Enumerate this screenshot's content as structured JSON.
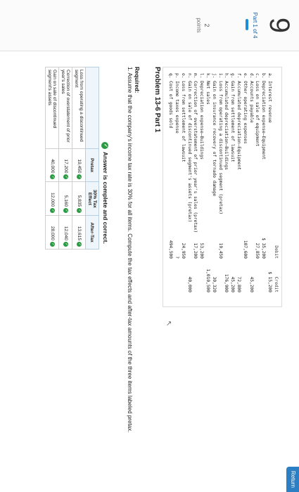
{
  "rail": {
    "question_number": "9",
    "part_label": "Part 1 of 4",
    "points_value": "2",
    "points_label": "points"
  },
  "return_button": "Return",
  "ledger": {
    "header": {
      "debit": "Debit",
      "credit": "Credit"
    },
    "rows": [
      {
        "account": "a. Interest revenue",
        "debit": "",
        "credit": "$ 15,200"
      },
      {
        "account": "b. Depreciation expense—Equipment",
        "debit": "$ 35,200",
        "credit": ""
      },
      {
        "account": "c. Loss on sale of equipment",
        "debit": "27,850",
        "credit": ""
      },
      {
        "account": "d. Accounts payable",
        "debit": "",
        "credit": "45,200"
      },
      {
        "account": "e. Other operating expenses",
        "debit": "107,600",
        "credit": ""
      },
      {
        "account": "f. Accumulated depreciation—Equipment",
        "debit": "",
        "credit": "72,800"
      },
      {
        "account": "g. Gain from settlement of lawsuit",
        "debit": "",
        "credit": "45,200"
      },
      {
        "account": "h. Accumulated depreciation—Buildings",
        "debit": "",
        "credit": "176,900"
      },
      {
        "account": "i. Loss from operating a discontinued segment (pretax)",
        "debit": "19,450",
        "credit": ""
      },
      {
        "account": "j. Gain on insurance recovery of tornado damage",
        "debit": "",
        "credit": "30,320"
      },
      {
        "account": "k. Net sales",
        "debit": "",
        "credit": "1,010,500"
      },
      {
        "account": "l. Depreciation expense—Buildings",
        "debit": "53,200",
        "credit": ""
      },
      {
        "account": "m. Correction of overstatement of prior year's sales (pretax)",
        "debit": "17,200",
        "credit": ""
      },
      {
        "account": "n. Gain on sale of discontinued segment's assets (pretax)",
        "debit": "",
        "credit": "40,000"
      },
      {
        "account": "o. Loss from settlement of lawsuit",
        "debit": "24,950",
        "credit": ""
      },
      {
        "account": "p. Income taxes expense",
        "debit": "?",
        "credit": ""
      },
      {
        "account": "q. Cost of goods sold",
        "debit": "494,500",
        "credit": ""
      }
    ]
  },
  "problem": {
    "title": "Problem 13-6 Part 1",
    "required_label": "Required:",
    "required_text": "1. Assume that the company's income tax rate is 30% for all items. Compute the tax effects and after-tax amounts of the three items labeled pretax.",
    "answer_banner": "Answer is complete and correct."
  },
  "answer_table": {
    "headers": [
      "",
      "Pretax",
      "30% Tax Effect",
      "After-Tax"
    ],
    "rows": [
      {
        "label": "Loss from operating a discontinued segment",
        "pretax": "19,450",
        "tax": "5,835",
        "after": "13,615"
      },
      {
        "label": "Correction of overstatement of prior year's sales",
        "pretax": "17,200",
        "tax": "5,160",
        "after": "12,040"
      },
      {
        "label": "Gain on sale of discontinued segment's assets",
        "pretax": "40,000",
        "tax": "12,000",
        "after": "28,000"
      }
    ]
  }
}
